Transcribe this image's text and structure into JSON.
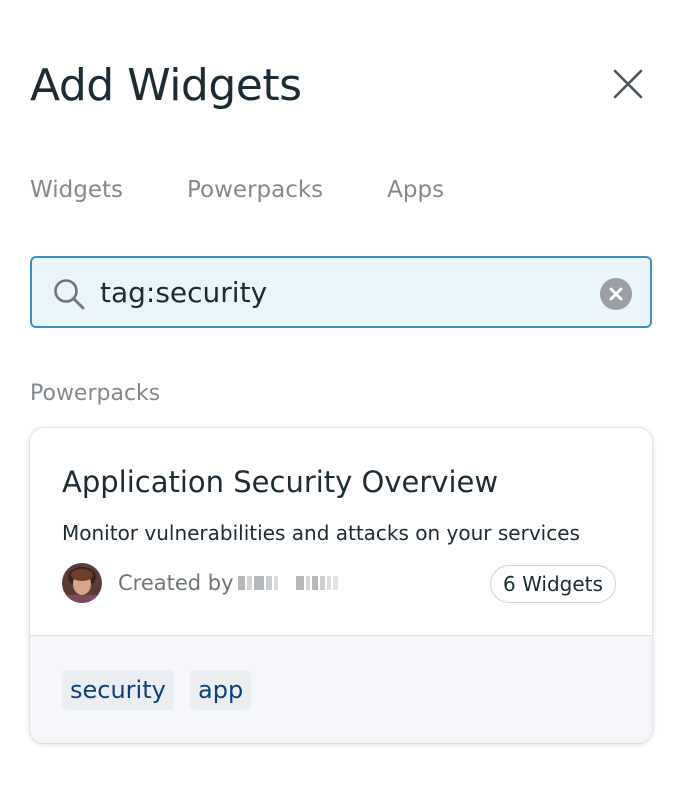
{
  "header": {
    "title": "Add Widgets",
    "close_icon": "close-icon"
  },
  "tabs": [
    {
      "label": "Widgets"
    },
    {
      "label": "Powerpacks"
    },
    {
      "label": "Apps"
    }
  ],
  "search": {
    "value": "tag:security",
    "icon": "search-icon",
    "clear_icon": "clear-icon"
  },
  "section": {
    "label": "Powerpacks"
  },
  "card": {
    "title": "Application Security Overview",
    "description": "Monitor vulnerabilities and attacks on your services",
    "created_by_label": "Created by",
    "widget_count": "6 Widgets",
    "tags": [
      "security",
      "app"
    ]
  },
  "colors": {
    "accent": "#3a8fc6",
    "search_bg": "#e9f4fb",
    "tag_text": "#0d3f7a",
    "tag_bg": "#eaedf2"
  }
}
